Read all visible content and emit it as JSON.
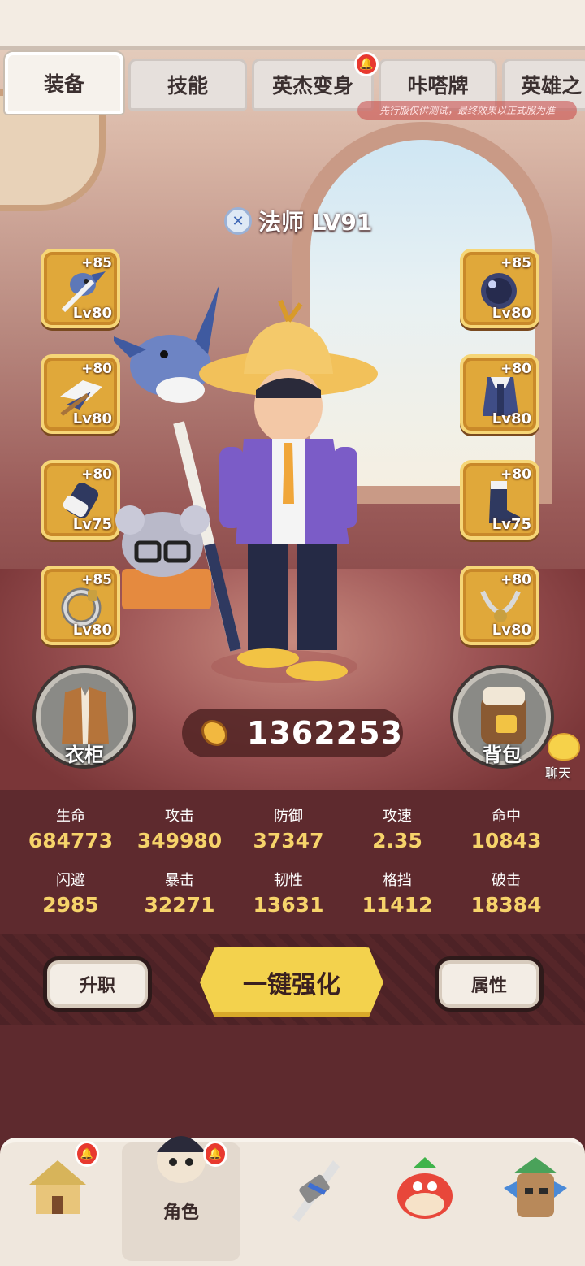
{
  "tabs": [
    {
      "label": "装备",
      "active": true,
      "badge": false
    },
    {
      "label": "技能",
      "active": false,
      "badge": false
    },
    {
      "label": "英杰变身",
      "active": false,
      "badge": true
    },
    {
      "label": "咔嗒牌",
      "active": false,
      "badge": false
    },
    {
      "label": "英雄之",
      "active": false,
      "badge": false
    }
  ],
  "notice": "先行服仅供测试，最终效果以正式服为准",
  "character": {
    "class_level": "法师 LV91"
  },
  "equipment_left": [
    {
      "plus": "+85",
      "level": "Lv80",
      "icon": "staff-bird-icon"
    },
    {
      "plus": "+80",
      "level": "Lv80",
      "icon": "wing-weapon-icon"
    },
    {
      "plus": "+80",
      "level": "Lv75",
      "icon": "bracer-icon"
    },
    {
      "plus": "+85",
      "level": "Lv80",
      "icon": "ring-icon"
    }
  ],
  "equipment_right": [
    {
      "plus": "+85",
      "level": "Lv80",
      "icon": "orb-icon"
    },
    {
      "plus": "+80",
      "level": "Lv80",
      "icon": "robe-icon"
    },
    {
      "plus": "+80",
      "level": "Lv75",
      "icon": "boots-icon"
    },
    {
      "plus": "+80",
      "level": "Lv80",
      "icon": "necklace-icon"
    }
  ],
  "wardrobe_label": "衣柜",
  "backpack_label": "背包",
  "power": "1362253",
  "chat_label": "聊天",
  "stats": [
    {
      "label": "生命",
      "value": "684773"
    },
    {
      "label": "攻击",
      "value": "349980"
    },
    {
      "label": "防御",
      "value": "37347"
    },
    {
      "label": "攻速",
      "value": "2.35"
    },
    {
      "label": "命中",
      "value": "10843"
    },
    {
      "label": "闪避",
      "value": "2985"
    },
    {
      "label": "暴击",
      "value": "32271"
    },
    {
      "label": "韧性",
      "value": "13631"
    },
    {
      "label": "格挡",
      "value": "11412"
    },
    {
      "label": "破击",
      "value": "18384"
    }
  ],
  "buttons": {
    "promote": "升职",
    "enhance_all": "一键强化",
    "attributes": "属性"
  },
  "bottom_nav": [
    {
      "label": "",
      "icon": "hut-icon",
      "badge": true
    },
    {
      "label": "角色",
      "icon": "character-icon",
      "badge": true,
      "active": true
    },
    {
      "label": "",
      "icon": "weapon-icon",
      "badge": false
    },
    {
      "label": "",
      "icon": "pet-icon",
      "badge": false
    },
    {
      "label": "",
      "icon": "totem-icon",
      "badge": false
    }
  ],
  "colors": {
    "stat_value": "#f6d36a",
    "slot_gold": "#e0a83a",
    "enhance_button": "#f3d24d",
    "badge_red": "#e8392f"
  }
}
